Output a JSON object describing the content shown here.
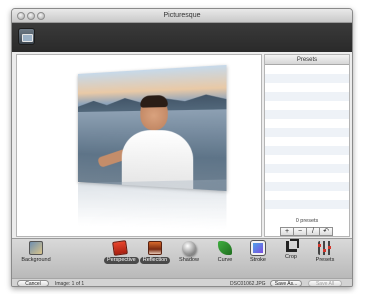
{
  "window": {
    "title": "Picturesque"
  },
  "presets": {
    "header": "Presets",
    "count_label": "0 presets",
    "buttons": [
      "+",
      "−",
      "/",
      "↶"
    ]
  },
  "tools": [
    {
      "id": "background",
      "label": "Background",
      "icon": "background-icon"
    },
    {
      "id": "perspective",
      "label": "Perspective",
      "icon": "perspective-icon"
    },
    {
      "id": "reflection",
      "label": "Reflection",
      "icon": "reflection-icon"
    },
    {
      "id": "shadow",
      "label": "Shadow",
      "icon": "shadow-icon"
    },
    {
      "id": "curve",
      "label": "Curve",
      "icon": "curve-icon"
    },
    {
      "id": "stroke",
      "label": "Stroke",
      "icon": "stroke-icon"
    },
    {
      "id": "crop",
      "label": "Crop",
      "icon": "crop-icon"
    },
    {
      "id": "presets",
      "label": "Presets",
      "icon": "presets-sliders-icon"
    }
  ],
  "status": {
    "cancel_label": "Cancel",
    "image_counter": "Image: 1 of 1",
    "filename": "DSC01062.JPG",
    "save_as_label": "Save As...",
    "save_all_label": "Save All"
  }
}
